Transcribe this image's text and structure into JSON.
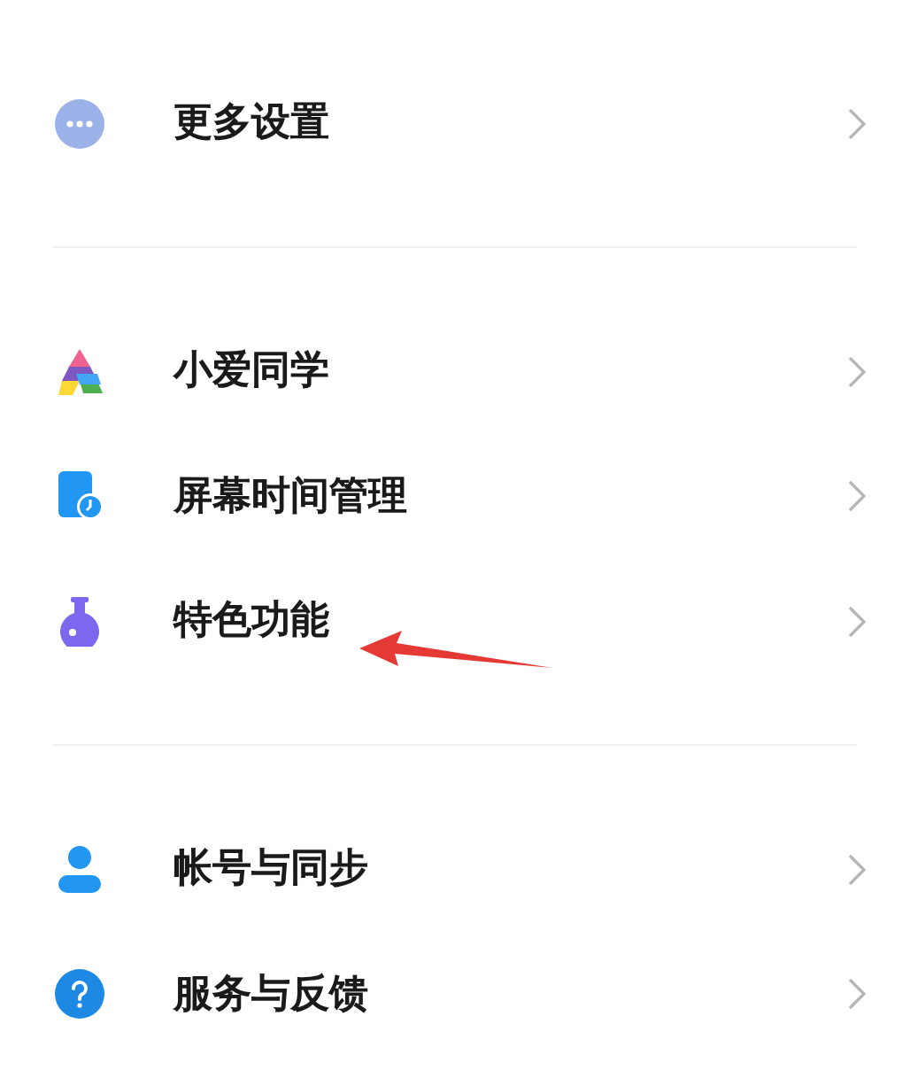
{
  "groups": [
    {
      "items": [
        {
          "kind": "more",
          "label": "更多设置"
        }
      ]
    },
    {
      "items": [
        {
          "kind": "assistant",
          "label": "小爱同学"
        },
        {
          "kind": "screen-time",
          "label": "屏幕时间管理"
        },
        {
          "kind": "flask",
          "label": "特色功能"
        }
      ]
    },
    {
      "items": [
        {
          "kind": "account",
          "label": "帐号与同步"
        },
        {
          "kind": "help",
          "label": "服务与反馈"
        }
      ]
    }
  ]
}
